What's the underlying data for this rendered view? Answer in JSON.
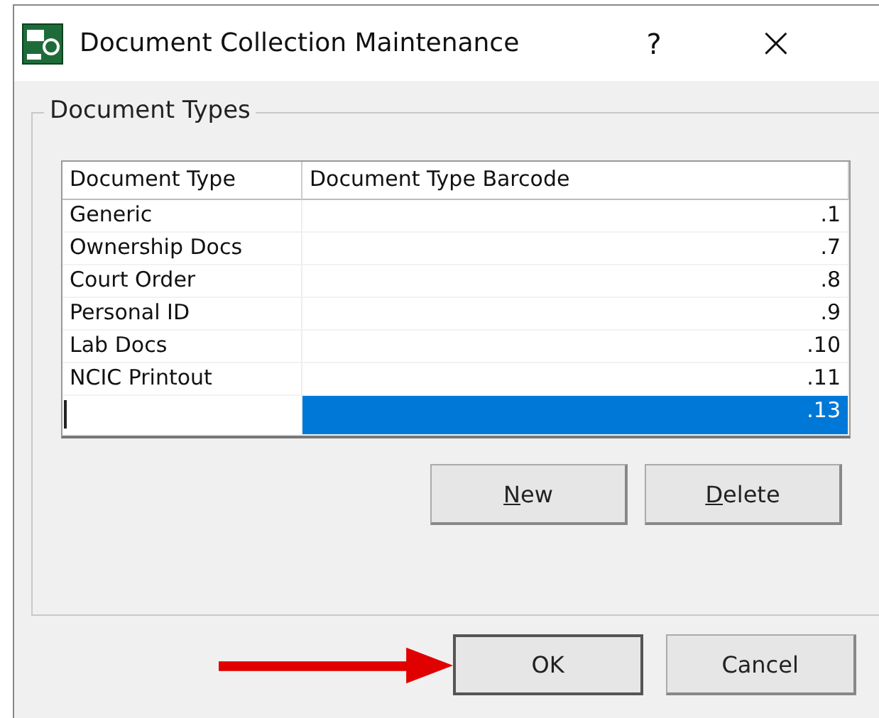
{
  "window": {
    "title": "Document Collection Maintenance",
    "help": "?",
    "close": "×"
  },
  "group": {
    "title": "Document Types",
    "table": {
      "columns": [
        "Document Type",
        "Document Type Barcode"
      ],
      "rows": [
        {
          "type": "Generic",
          "barcode": ".1",
          "selected": false
        },
        {
          "type": "Ownership Docs",
          "barcode": ".7",
          "selected": false
        },
        {
          "type": "Court Order",
          "barcode": ".8",
          "selected": false
        },
        {
          "type": "Personal ID",
          "barcode": ".9",
          "selected": false
        },
        {
          "type": "Lab Docs",
          "barcode": ".10",
          "selected": false
        },
        {
          "type": "NCIC Printout",
          "barcode": ".11",
          "selected": false
        },
        {
          "barcode": ".13",
          "selected": true
        }
      ]
    },
    "buttons": [
      {
        "label": "New",
        "access_key": true
      },
      {
        "label": "Delete",
        "access_key": true
      }
    ]
  },
  "footer_buttons": [
    {
      "label": "OK",
      "access_key": false,
      "default": true
    },
    {
      "label": "Cancel",
      "access_key": false,
      "default": false
    }
  ],
  "annotation": {
    "kind": "arrow"
  }
}
